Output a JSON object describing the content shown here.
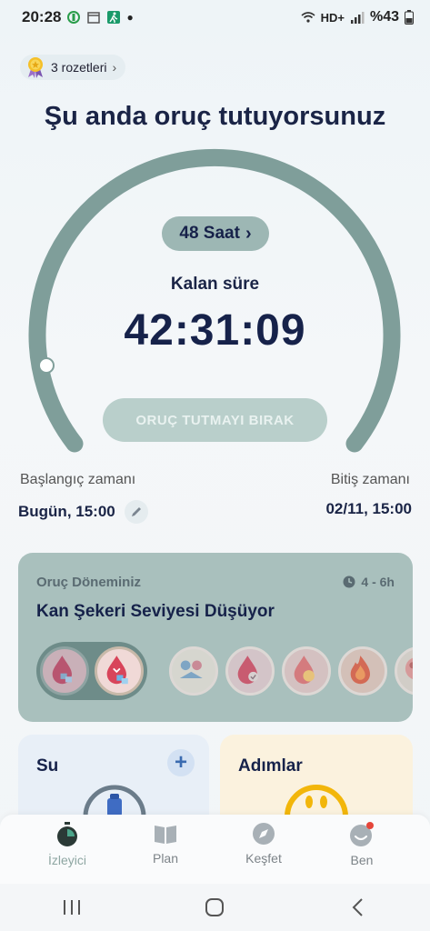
{
  "status": {
    "time": "20:28",
    "battery": "%43",
    "network": "HD+"
  },
  "badges": {
    "label": "3 rozetleri"
  },
  "title": "Şu anda oruç tutuyorsunuz",
  "timer": {
    "duration_label": "48 Saat",
    "remaining_label": "Kalan süre",
    "remaining_value": "42:31:09",
    "stop_label": "ORUÇ TUTMAYI BIRAK"
  },
  "schedule": {
    "start_label": "Başlangıç zamanı",
    "start_value": "Bugün, 15:00",
    "end_label": "Bitiş zamanı",
    "end_value": "02/11, 15:00"
  },
  "phase": {
    "label": "Oruç Döneminiz",
    "time": "4 - 6h",
    "title": "Kan Şekeri Seviyesi Düşüyor"
  },
  "water": {
    "title": "Su"
  },
  "steps": {
    "title": "Adımlar"
  },
  "nav": {
    "items": [
      {
        "label": "İzleyici"
      },
      {
        "label": "Plan"
      },
      {
        "label": "Keşfet"
      },
      {
        "label": "Ben"
      }
    ]
  },
  "colors": {
    "accent": "#6e8c89",
    "title": "#1a2446",
    "gauge_track": "#7f9e9a"
  }
}
